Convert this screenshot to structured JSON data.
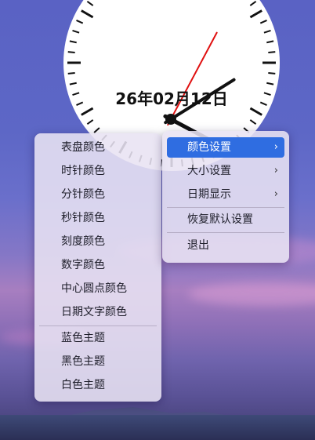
{
  "clock": {
    "date_text": "26年02月12日"
  },
  "color_menu": {
    "items": [
      "表盘颜色",
      "时针颜色",
      "分针颜色",
      "秒针颜色",
      "刻度颜色",
      "数字颜色",
      "中心圆点颜色",
      "日期文字颜色"
    ],
    "themes": [
      "蓝色主题",
      "黑色主题",
      "白色主题"
    ]
  },
  "main_menu": {
    "items": [
      {
        "label": "颜色设置",
        "submenu": true,
        "active": true
      },
      {
        "label": "大小设置",
        "submenu": true,
        "active": false
      },
      {
        "label": "日期显示",
        "submenu": true,
        "active": false
      },
      {
        "label": "恢复默认设置",
        "submenu": false,
        "active": false
      },
      {
        "label": "退出",
        "submenu": false,
        "active": false
      }
    ],
    "submenu_arrow": "›"
  },
  "colors": {
    "active_item": "#2f6de1",
    "second_hand": "#e01010",
    "clock_face": "#ffffff"
  }
}
